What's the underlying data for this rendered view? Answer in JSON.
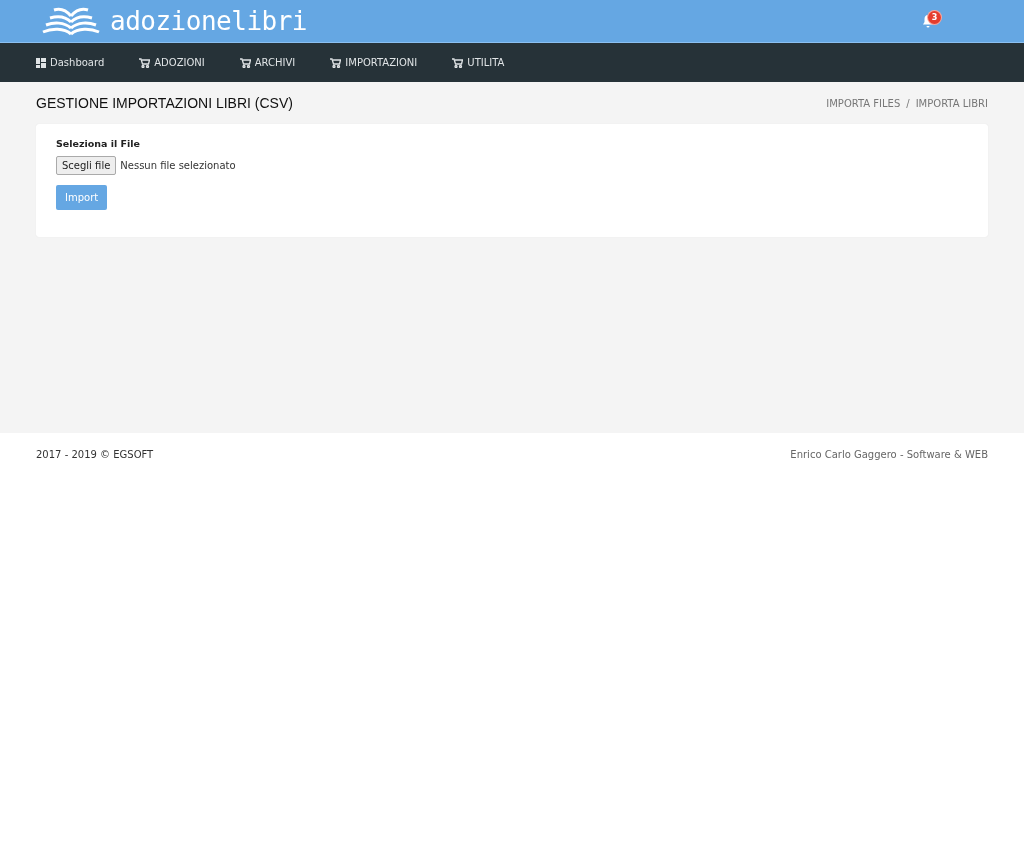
{
  "header": {
    "logo_text": "adozionelibri",
    "notifications": {
      "count": "3"
    }
  },
  "nav": [
    {
      "label": "Dashboard",
      "kind": "dashboard"
    },
    {
      "label": "ADOZIONI",
      "kind": "cart"
    },
    {
      "label": "ARCHIVI",
      "kind": "cart"
    },
    {
      "label": "IMPORTAZIONI",
      "kind": "cart"
    },
    {
      "label": "UTILITA",
      "kind": "cart"
    }
  ],
  "page": {
    "title": "GESTIONE IMPORTAZIONI LIBRI (CSV)",
    "breadcrumb": [
      "IMPORTA FILES",
      "IMPORTA LIBRI"
    ],
    "breadcrumb_separator": "/"
  },
  "form": {
    "label": "Seleziona il File",
    "file_button": "Scegli file",
    "file_status": "Nessun file selezionato",
    "submit": "Import"
  },
  "footer": {
    "left": "2017 - 2019 © EGSOFT",
    "right": "Enrico Carlo Gaggero - Software & WEB"
  }
}
